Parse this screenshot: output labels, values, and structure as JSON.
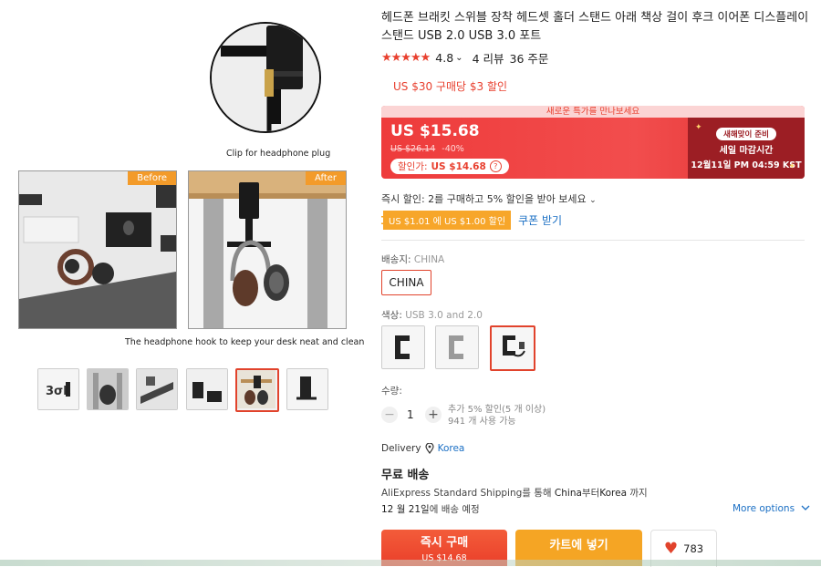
{
  "gallery": {
    "detail_caption": "Clip for headphone plug",
    "before_tag": "Before",
    "after_tag": "After",
    "main_caption": "The headphone hook to keep your desk neat and clean",
    "thumbnails": [
      {
        "text": "3σL"
      },
      {
        "text": ""
      },
      {
        "text": ""
      },
      {
        "text": ""
      },
      {
        "text": ""
      },
      {
        "text": ""
      }
    ]
  },
  "product": {
    "title": "헤드폰 브래킷 스위블 장착 헤드셋 홀더 스탠드 아래 책상 걸이 후크 이어폰 디스플레이 스탠드 USB 2.0 USB 3.0 포트",
    "stars": "★★★★★",
    "rating": "4.8",
    "rating_caret": "⌄",
    "reviews": "4 리뷰",
    "orders": "36 주문"
  },
  "promo": {
    "line": "US $30 구매당 $3 할인"
  },
  "price": {
    "banner": "새로운 특가를 만나보세요",
    "current": "US $15.68",
    "original": "US $26.14",
    "discount": "-40%",
    "coupon_label": "할인가:",
    "coupon_price": "US $14.68",
    "help_icon": "?"
  },
  "countdown": {
    "badge": "새해맞이 준비",
    "line1": "세일 마감시간",
    "line2": "12월11일 PM 04:59 KST"
  },
  "instant_discount": {
    "text": "즉시 할인: 2를 구매하고 5% 할인을 받아 보세요",
    "caret": "⌄",
    "coupon_tag": "US $1.01 에 US $1.00 할인",
    "coupon_link": "쿠폰 받기"
  },
  "shipping_from": {
    "label": "배송지:",
    "value": "CHINA",
    "option": "CHINA"
  },
  "color": {
    "label": "색상:",
    "value": "USB 3.0 and 2.0"
  },
  "quantity": {
    "label": "수량:",
    "minus": "−",
    "value": "1",
    "plus": "+",
    "info1": "추가 5% 할인(5 개 이상)",
    "info2": "941 개 사용 가능"
  },
  "delivery": {
    "label": "Delivery",
    "country": "Korea",
    "free": "무료 배송",
    "desc_prefix": "AliExpress Standard Shipping",
    "desc_mid": "를 통해 ",
    "desc_from": "China",
    "desc_from_suffix": "부터",
    "desc_to": "Korea",
    "desc_suffix": " 까지",
    "date_prefix": "12 월 21일",
    "date_suffix": "에 배송 예정",
    "more": "More options"
  },
  "actions": {
    "buy_now": "즉시 구매",
    "buy_now_price": "US $14.68",
    "add_cart": "카트에 넣기",
    "wishlist_count": "783"
  },
  "colors": {
    "accent": "#e8402f",
    "link": "#1a6fc4",
    "cart": "#f5a524",
    "countdown_bg": "#9c1e24"
  }
}
